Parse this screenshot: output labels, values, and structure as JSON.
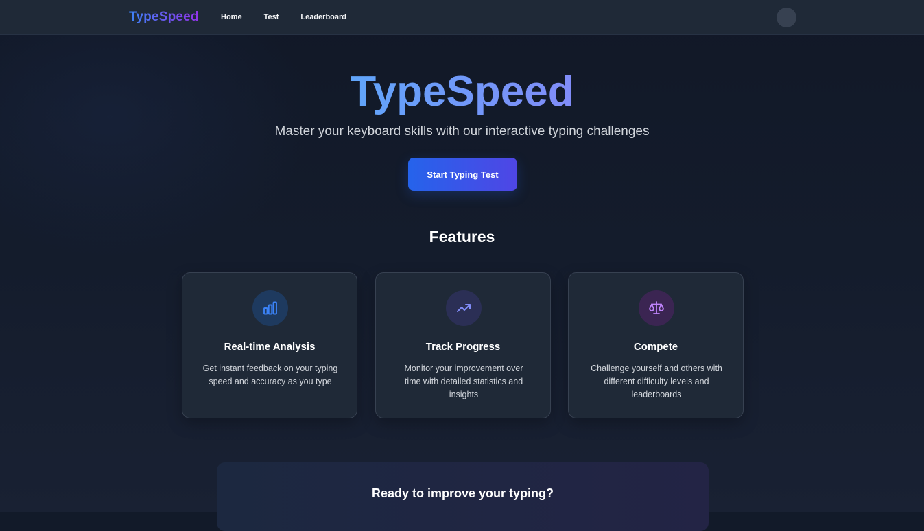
{
  "header": {
    "brand": "TypeSpeed",
    "nav": [
      {
        "label": "Home"
      },
      {
        "label": "Test"
      },
      {
        "label": "Leaderboard"
      }
    ]
  },
  "hero": {
    "title": "TypeSpeed",
    "subtitle": "Master your keyboard skills with our interactive typing challenges",
    "cta_label": "Start Typing Test"
  },
  "features": {
    "heading": "Features",
    "cards": [
      {
        "icon": "bar-chart-icon",
        "title": "Real-time Analysis",
        "description": "Get instant feedback on your typing speed and accuracy as you type",
        "icon_color": "#3b82f6",
        "icon_bg": "#1e3a5f"
      },
      {
        "icon": "trending-up-icon",
        "title": "Track Progress",
        "description": "Monitor your improvement over time with detailed statistics and insights",
        "icon_color": "#818cf8",
        "icon_bg": "#2b2f55"
      },
      {
        "icon": "scale-icon",
        "title": "Compete",
        "description": "Challenge yourself and others with different difficulty levels and leaderboards",
        "icon_color": "#c084fc",
        "icon_bg": "#3b2552"
      }
    ]
  },
  "bottom_cta": {
    "title": "Ready to improve your typing?"
  },
  "colors": {
    "background": "#111827",
    "surface": "#1f2937",
    "accent_blue": "#2563eb",
    "accent_indigo": "#4f46e5",
    "brand_purple": "#9333ea"
  }
}
